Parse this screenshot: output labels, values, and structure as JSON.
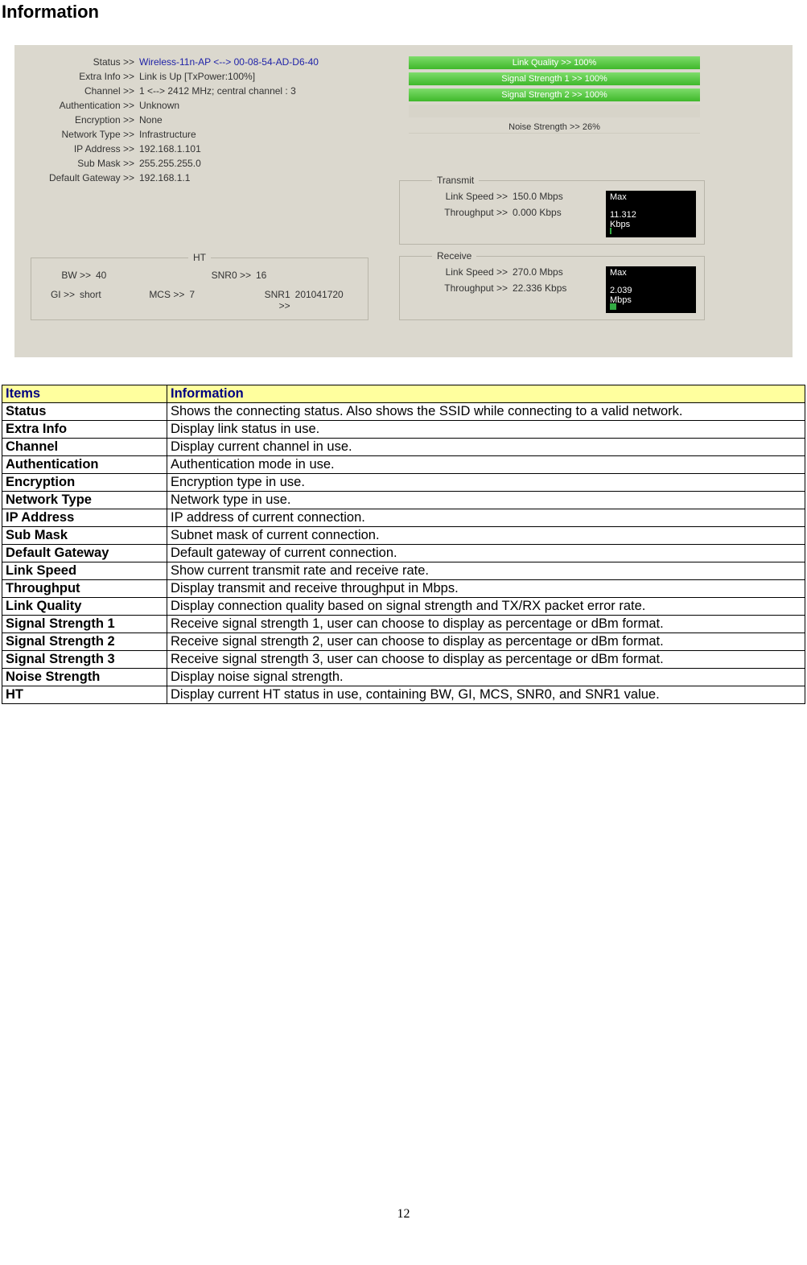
{
  "page_title": "Information",
  "page_number": "12",
  "screenshot": {
    "left": {
      "status_label": "Status >>",
      "status_value": "Wireless-11n-AP <--> 00-08-54-AD-D6-40",
      "extra_label": "Extra Info >>",
      "extra_value": "Link is Up [TxPower:100%]",
      "channel_label": "Channel >>",
      "channel_value": "1 <--> 2412 MHz; central channel : 3",
      "auth_label": "Authentication >>",
      "auth_value": "Unknown",
      "enc_label": "Encryption >>",
      "enc_value": "None",
      "net_label": "Network Type >>",
      "net_value": "Infrastructure",
      "ip_label": "IP Address >>",
      "ip_value": "192.168.1.101",
      "mask_label": "Sub Mask >>",
      "mask_value": "255.255.255.0",
      "gw_label": "Default Gateway >>",
      "gw_value": "192.168.1.1"
    },
    "ht": {
      "legend": "HT",
      "bw_k": "BW >>",
      "bw_v": "40",
      "snr0_k": "SNR0 >>",
      "snr0_v": "16",
      "gi_k": "GI >>",
      "gi_v": "short",
      "mcs_k": "MCS >>",
      "mcs_v": "7",
      "snr1_k": "SNR1 >>",
      "snr1_v": "201041720"
    },
    "bars": {
      "lq": "Link Quality >> 100%",
      "ss1": "Signal Strength 1 >> 100%",
      "ss2": "Signal Strength 2 >> 100%",
      "ns": "Noise Strength >> 26%"
    },
    "tx": {
      "legend": "Transmit",
      "ls_k": "Link Speed >>",
      "ls_v": "150.0 Mbps",
      "tp_k": "Throughput >>",
      "tp_v": "0.000 Kbps",
      "meter_top": "Max",
      "meter_val": "11.312",
      "meter_unit": "Kbps"
    },
    "rx": {
      "legend": "Receive",
      "ls_k": "Link Speed >>",
      "ls_v": "270.0 Mbps",
      "tp_k": "Throughput >>",
      "tp_v": "22.336 Kbps",
      "meter_top": "Max",
      "meter_val": "2.039",
      "meter_unit": "Mbps"
    }
  },
  "table": {
    "head_a": "Items",
    "head_b": "Information",
    "rows": [
      {
        "a": "Status",
        "b": "Shows the connecting status. Also shows the SSID while connecting to a valid network."
      },
      {
        "a": "Extra Info",
        "b": "Display link status in use."
      },
      {
        "a": "Channel",
        "b": "Display current channel in use."
      },
      {
        "a": "Authentication",
        "b": "Authentication mode in use."
      },
      {
        "a": "Encryption",
        "b": "Encryption type in use."
      },
      {
        "a": "Network Type",
        "b": "Network type in use."
      },
      {
        "a": "IP Address",
        "b": "IP address of current connection."
      },
      {
        "a": "Sub Mask",
        "b": "Subnet mask of current connection."
      },
      {
        "a": "Default Gateway",
        "b": "Default gateway of current connection."
      },
      {
        "a": "Link Speed",
        "b": "Show current transmit rate and receive rate."
      },
      {
        "a": "Throughput",
        "b": "Display transmit and receive throughput in Mbps."
      },
      {
        "a": "Link Quality",
        "b": "Display connection quality based on signal strength and TX/RX packet error rate."
      },
      {
        "a": "Signal Strength 1",
        "b": "Receive signal strength 1, user can choose to display as percentage or dBm format."
      },
      {
        "a": "Signal Strength 2",
        "b": "Receive signal strength 2, user can choose to display as percentage or dBm format."
      },
      {
        "a": "Signal Strength 3",
        "b": "Receive signal strength 3, user can choose to display as percentage or dBm format."
      },
      {
        "a": "Noise Strength",
        "b": "Display noise signal strength."
      },
      {
        "a": "HT",
        "b": "Display current HT status in use, containing BW, GI, MCS, SNR0, and SNR1 value."
      }
    ]
  }
}
